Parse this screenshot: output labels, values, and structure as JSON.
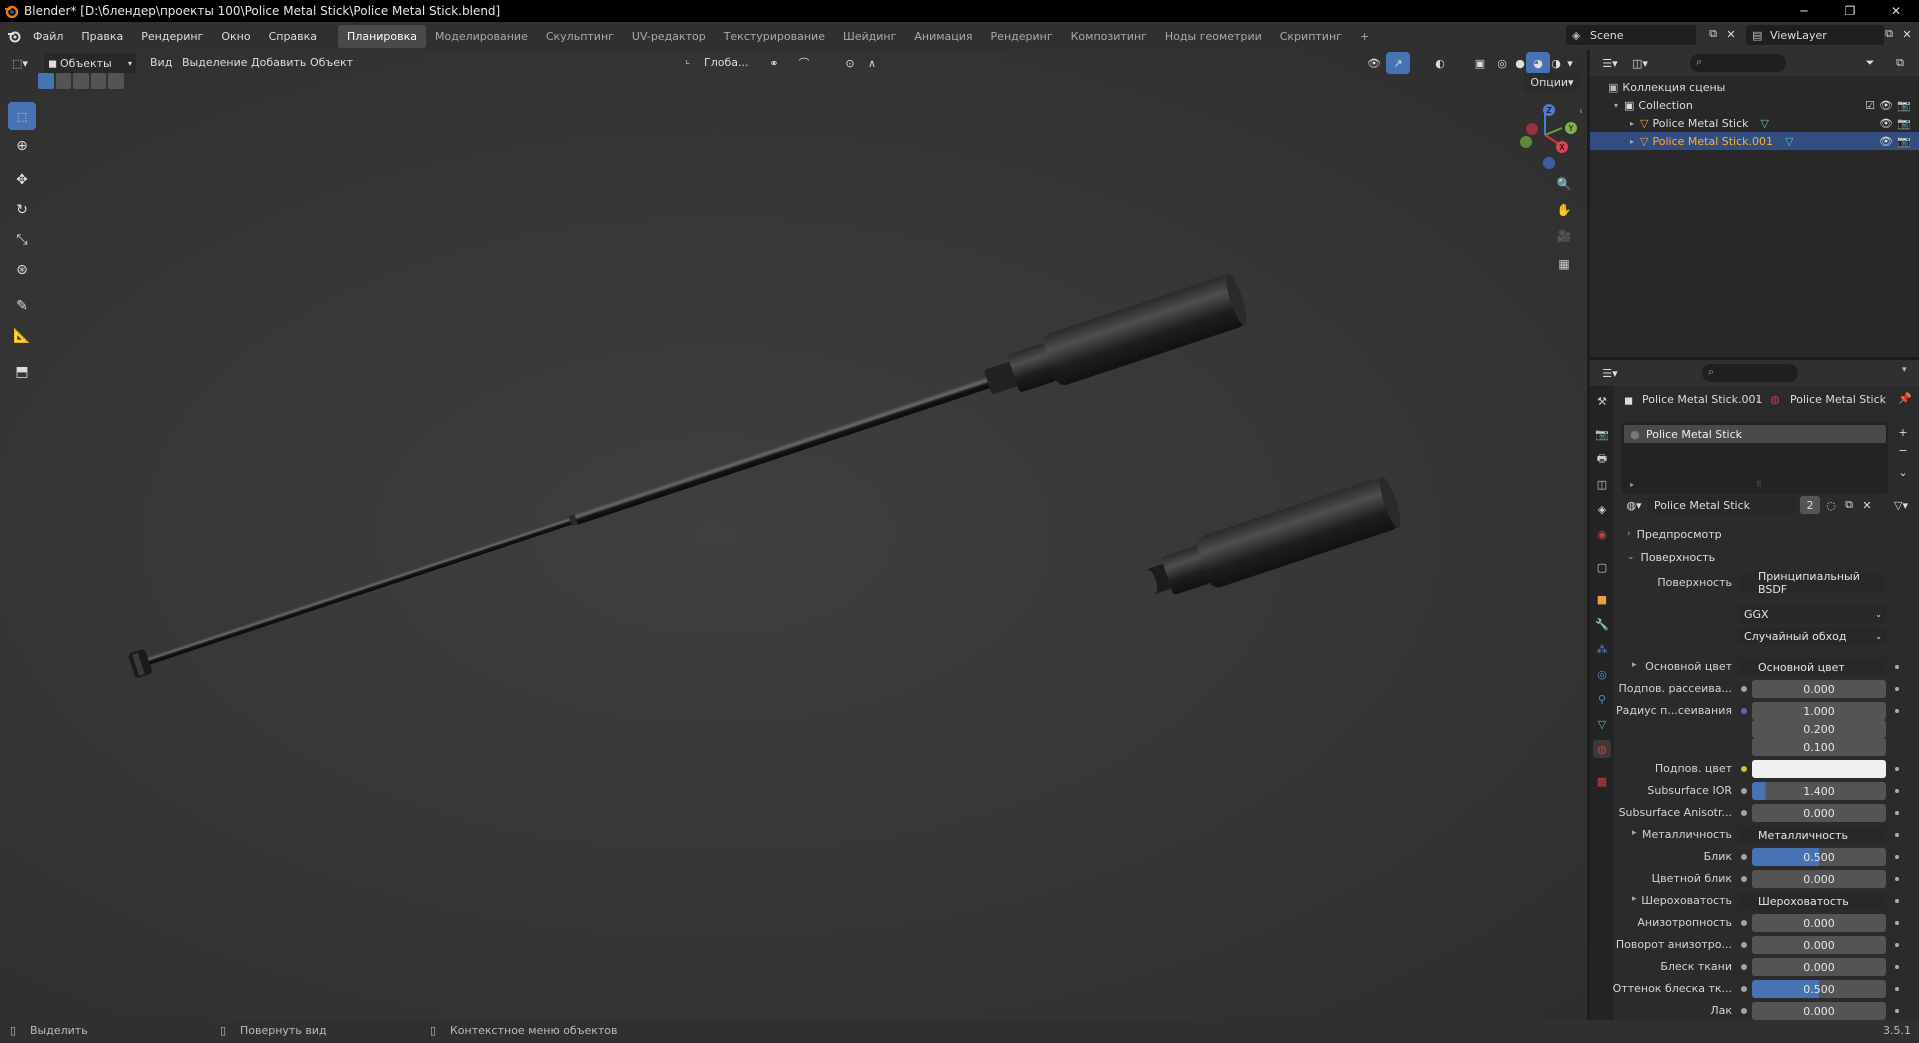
{
  "window": {
    "title": "Blender* [D:\\блендер\\проекты 100\\Police Metal Stick\\Police Metal Stick.blend]"
  },
  "menu": [
    "Файл",
    "Правка",
    "Рендеринг",
    "Окно",
    "Справка"
  ],
  "workspaces": [
    "Планировка",
    "Моделирование",
    "Скульптинг",
    "UV-редактор",
    "Текстурирование",
    "Шейдинг",
    "Анимация",
    "Рендеринг",
    "Композитинг",
    "Ноды геометрии",
    "Скриптинг",
    "+"
  ],
  "scene": {
    "name": "Scene",
    "view_layer": "ViewLayer"
  },
  "viewport": {
    "mode": "Объекты",
    "menus": [
      "Вид",
      "Выделение",
      "Добавить",
      "Объект"
    ],
    "orientation": "Глоба...",
    "options": "Опции",
    "gizmo_axes": [
      "Z",
      "Y",
      "X"
    ]
  },
  "outliner": {
    "root": "Коллекция сцены",
    "collection": "Collection",
    "objects": [
      {
        "name": "Police Metal Stick",
        "selected": false
      },
      {
        "name": "Police Metal Stick.001",
        "selected": true
      }
    ]
  },
  "properties": {
    "breadcrumb_object": "Police Metal Stick.001",
    "breadcrumb_material": "Police Metal Stick",
    "slot": "Police Metal Stick",
    "material_name": "Police Metal Stick",
    "users": "2",
    "panels": {
      "preview": "Предпросмотр",
      "surface": "Поверхность"
    },
    "surface_label": "Поверхность",
    "surface_value": "Принципиальный BSDF",
    "distribution": "GGX",
    "sss_method": "Случайный обход",
    "rows": [
      {
        "label": "Основной цвет",
        "value": "Основной цвет",
        "kind": "link",
        "dot": "#c7c729",
        "expand": true
      },
      {
        "label": "Подпов. рассеива...",
        "value": "0.000",
        "kind": "num",
        "dot": "#a1a1a1"
      },
      {
        "label": "Радиус п...сеивания",
        "value": "1.000",
        "kind": "num",
        "dot": "#6363c7"
      },
      {
        "label": "",
        "value": "0.200",
        "kind": "num"
      },
      {
        "label": "",
        "value": "0.100",
        "kind": "num"
      },
      {
        "label": "Подпов. цвет",
        "value": "",
        "kind": "white",
        "dot": "#c7c729"
      },
      {
        "label": "Subsurface IOR",
        "value": "1.400",
        "kind": "num",
        "dot": "#a1a1a1",
        "fill": 0.1
      },
      {
        "label": "Subsurface Anisotr...",
        "value": "0.000",
        "kind": "num",
        "dot": "#a1a1a1"
      },
      {
        "label": "Металличность",
        "value": "Металличность",
        "kind": "link",
        "dot": "#a1a1a1",
        "expand": true
      },
      {
        "label": "Блик",
        "value": "0.500",
        "kind": "num",
        "dot": "#a1a1a1",
        "fill": 0.5
      },
      {
        "label": "Цветной блик",
        "value": "0.000",
        "kind": "num",
        "dot": "#a1a1a1"
      },
      {
        "label": "Шероховатость",
        "value": "Шероховатость",
        "kind": "link",
        "dot": "#a1a1a1",
        "expand": true
      },
      {
        "label": "Анизотропность",
        "value": "0.000",
        "kind": "num",
        "dot": "#a1a1a1"
      },
      {
        "label": "Поворот анизотро...",
        "value": "0.000",
        "kind": "num",
        "dot": "#a1a1a1"
      },
      {
        "label": "Блеск ткани",
        "value": "0.000",
        "kind": "num",
        "dot": "#a1a1a1"
      },
      {
        "label": "Оттенок блеска тк...",
        "value": "0.500",
        "kind": "num",
        "dot": "#a1a1a1",
        "fill": 0.5
      },
      {
        "label": "Лак",
        "value": "0.000",
        "kind": "num",
        "dot": "#a1a1a1"
      }
    ]
  },
  "statusbar": {
    "select": "Выделить",
    "rotate": "Повернуть вид",
    "context": "Контекстное меню объектов",
    "version": "3.5.1"
  }
}
